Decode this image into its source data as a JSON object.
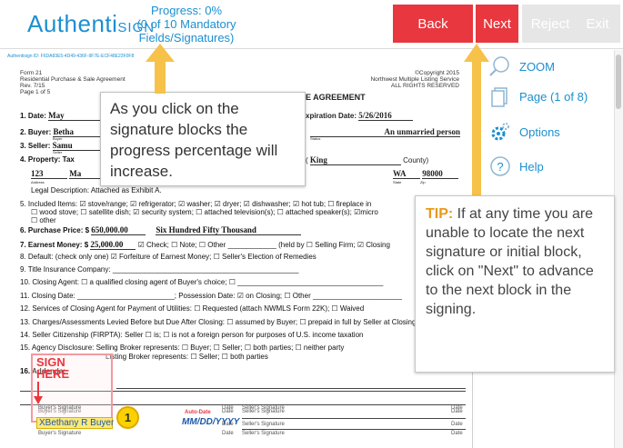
{
  "header": {
    "logo": "Authentisign",
    "logo_main": "Authenti",
    "logo_small": "SIGN",
    "progress_line1": "Progress: 0%",
    "progress_line2": "(0 of 10 Mandatory",
    "progress_line3": "Fields/Signatures)",
    "back_label": "Back",
    "next_label": "Next",
    "reject_label": "Reject",
    "exit_label": "Exit"
  },
  "doc": {
    "id_text": "Authentisign ID: F6DA83E5-4D49-436F-9F7E-ECF48E23F0F8",
    "form_left": [
      "Form 21",
      "Residential Purchase & Sale Agreement",
      "Rev. 7/15",
      "Page 1 of 5"
    ],
    "form_right": [
      "©Copyright 2015",
      "Northwest Multiple Listing Service",
      "ALL RIGHTS RESERVED"
    ],
    "agreement_title": "E AGREEMENT",
    "line1_label": "1. Date:",
    "line1_value": "May",
    "expiration_label": "xpiration Date:",
    "expiration_value": "5/26/2016",
    "line2_label": "2. Buyer:",
    "line2_value": "Betha",
    "buyer_status_value": "An unmarried person",
    "buyer_sub": "Buyer",
    "status_sub": "Status",
    "line3_label": "3. Seller:",
    "line3_value": "Samu",
    "seller_sub": "Seller",
    "line4_label": "4. Property: Tax",
    "county_value": "King",
    "county_label": "County)",
    "address_value": "123",
    "address_value2": "Ma",
    "state_value": "WA",
    "zip_value": "98000",
    "address_sub": "Address",
    "state_sub": "State",
    "zip_sub": "Zip",
    "legal_desc": "Legal Description: Attached as Exhibit A.",
    "line5": "5. Included Items: ☑ stove/range; ☑ refrigerator; ☑ washer; ☑ dryer; ☑ dishwasher; ☑ hot tub; ☐ fireplace in",
    "line5b": "☐ wood stove; ☐ satellite dish; ☑ security system; ☐ attached television(s); ☐ attached speaker(s); ☑micro",
    "line5c": "☐ other",
    "line6_label": "6. Purchase Price: $",
    "line6_value": "650,000.00",
    "line6_words": "Six Hundred Fifty Thousand",
    "line7_label": "7. Earnest Money: $",
    "line7_value": "25,000.00",
    "line7_rest": "☑ Check; ☐ Note; ☐ Other ____________ (held by ☐ Selling Firm; ☑ Closing",
    "line8": "8. Default: (check only one) ☑ Forfeiture of Earnest Money; ☐ Seller's Election of Remedies",
    "line9": "9. Title Insurance Company: ______________________________________________",
    "line10": "10. Closing Agent: ☐ a qualified closing agent of Buyer's choice; ☐ ____________________________________",
    "line11": "11. Closing Date: ________________________; Possession Date: ☑ on Closing; ☐ Other ______________________",
    "line12": "12. Services of Closing Agent for Payment of Utilities: ☐ Requested (attach NWMLS Form 22K); ☐ Waived",
    "line13": "13. Charges/Assessments Levied Before but Due After Closing: ☐ assumed by Buyer; ☐ prepaid in full by Seller at Closing",
    "line14": "14. Seller Citizenship (FIRPTA): Seller ☐ is; ☐ is not a foreign person for purposes of U.S. income taxation",
    "line15": "15. Agency Disclosure: Selling Broker represents: ☐ Buyer; ☐ Seller; ☐ both parties; ☐ neither party",
    "line15b": "Listing Broker represents: ☐ Seller; ☐ both parties",
    "line16": "16. Addenda:",
    "buyers_sig_label": "Buyer's Signature",
    "date_label": "Date",
    "sellers_sig_label": "Seller's Signature",
    "sig_value": "Bethany R Buyer",
    "sig_prefix": "X",
    "autodate_label": "Auto-Date",
    "date_value": "MM/DD/YYYY"
  },
  "callout": {
    "text": "As you click on the signature blocks the progress percentage will increase."
  },
  "tip": {
    "label": "TIP:",
    "text": "If at any time you are unable to locate the next signature or initial block, click on \"Next\" to advance to the next block in the signing."
  },
  "sidebar": {
    "zoom": "ZOOM",
    "page": "Page (1 of 8)",
    "options": "Options",
    "help": "Help"
  },
  "sign_here": {
    "line1": "SIGN",
    "line2": "HERE",
    "badge": "1"
  },
  "colors": {
    "brand_blue": "#1c8fd0",
    "button_red": "#e8373e",
    "arrow_yellow": "#f6c24a",
    "tip_orange": "#e89a1a"
  }
}
